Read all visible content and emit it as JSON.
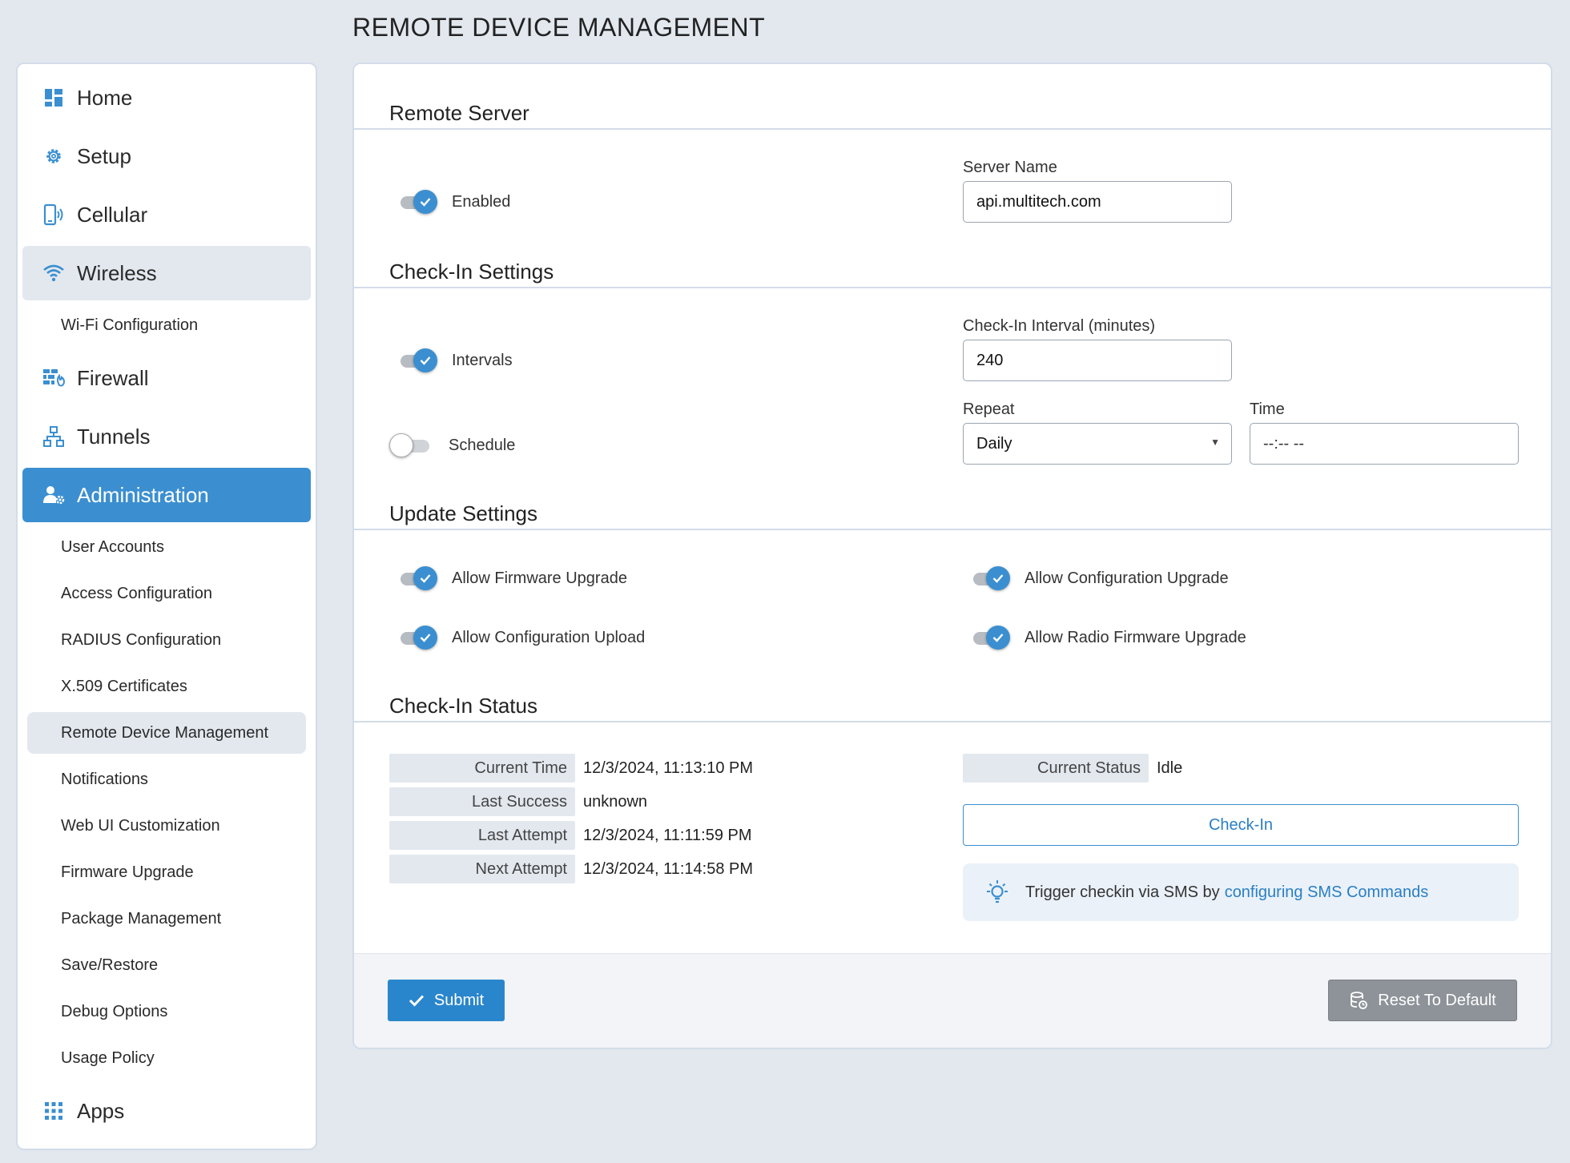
{
  "page": {
    "title": "REMOTE DEVICE MANAGEMENT"
  },
  "sidebar": {
    "home": "Home",
    "setup": "Setup",
    "cellular": "Cellular",
    "wireless": "Wireless",
    "wifi_config": "Wi-Fi Configuration",
    "firewall": "Firewall",
    "tunnels": "Tunnels",
    "administration": "Administration",
    "admin_items": [
      "User Accounts",
      "Access Configuration",
      "RADIUS Configuration",
      "X.509 Certificates",
      "Remote Device Management",
      "Notifications",
      "Web UI Customization",
      "Firmware Upgrade",
      "Package Management",
      "Save/Restore",
      "Debug Options",
      "Usage Policy"
    ],
    "apps": "Apps"
  },
  "remote_server": {
    "title": "Remote Server",
    "enabled_label": "Enabled",
    "enabled": true,
    "server_name_label": "Server Name",
    "server_name": "api.multitech.com"
  },
  "checkin_settings": {
    "title": "Check-In Settings",
    "intervals_label": "Intervals",
    "intervals": true,
    "interval_label": "Check-In Interval (minutes)",
    "interval_value": "240",
    "schedule_label": "Schedule",
    "schedule": false,
    "repeat_label": "Repeat",
    "repeat_value": "Daily",
    "time_label": "Time",
    "time_value": "--:-- --"
  },
  "update_settings": {
    "title": "Update Settings",
    "allow_firmware_upgrade": "Allow Firmware Upgrade",
    "allow_config_upgrade": "Allow Configuration Upgrade",
    "allow_config_upload": "Allow Configuration Upload",
    "allow_radio_firmware_upgrade": "Allow Radio Firmware Upgrade"
  },
  "checkin_status": {
    "title": "Check-In Status",
    "current_time_label": "Current Time",
    "current_time": "12/3/2024, 11:13:10 PM",
    "last_success_label": "Last Success",
    "last_success": "unknown",
    "last_attempt_label": "Last Attempt",
    "last_attempt": "12/3/2024, 11:11:59 PM",
    "next_attempt_label": "Next Attempt",
    "next_attempt": "12/3/2024, 11:14:58 PM",
    "current_status_label": "Current Status",
    "current_status": "Idle",
    "checkin_button": "Check-In",
    "hint_text": "Trigger checkin via SMS by",
    "hint_link": "configuring SMS Commands"
  },
  "footer": {
    "submit": "Submit",
    "reset": "Reset To Default"
  },
  "colors": {
    "accent": "#3b8fd0",
    "reset": "#8e9399"
  }
}
